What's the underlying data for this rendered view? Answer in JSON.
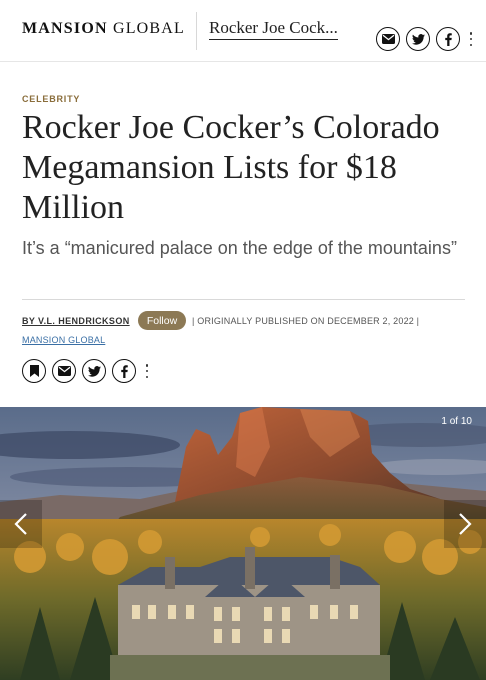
{
  "header": {
    "brand_bold": "MANSION",
    "brand_light": "GLOBAL",
    "title": "Rocker Joe Cock..."
  },
  "header_icons": [
    "email-icon",
    "twitter-icon",
    "facebook-icon",
    "more-vertical-icon"
  ],
  "article": {
    "category": "CELEBRITY",
    "headline": "Rocker Joe Cocker’s Colorado Megamansion Lists for $18 Million",
    "dek": "It’s a “manicured palace on the edge of the mountains”",
    "byline": "BY V.L. HENDRICKSON",
    "follow_label": "Follow",
    "published": "| ORIGINALLY PUBLISHED ON DECEMBER 2, 2022 |",
    "source": "MANSION GLOBAL"
  },
  "share_icons": [
    "bookmark-icon",
    "email-icon",
    "twitter-icon",
    "facebook-icon",
    "more-vertical-icon"
  ],
  "gallery": {
    "counter": "1 of 10"
  },
  "colors": {
    "follow_bg": "#8c7955",
    "category": "#8a6d3b",
    "link": "#3a6fa5"
  }
}
